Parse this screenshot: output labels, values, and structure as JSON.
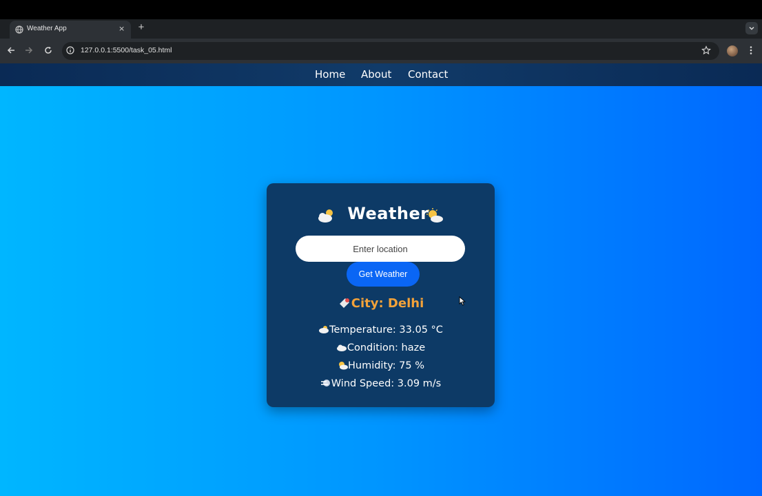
{
  "browser": {
    "tab_title": "Weather App",
    "tab_close": "×",
    "new_tab": "+",
    "url": "127.0.0.1:5500/task_05.html"
  },
  "site_nav": {
    "links": [
      "Home",
      "About",
      "Contact"
    ]
  },
  "weather_card": {
    "title": "Weather",
    "input_placeholder": "Enter location",
    "button_label": "Get Weather",
    "city_text": "City: Delhi",
    "temperature_text": "Temperature: 33.05 °C",
    "condition_text": "Condition: haze",
    "humidity_text": "Humidity: 75 %",
    "wind_text": "Wind Speed: 3.09 m/s"
  },
  "icons": {
    "title_left": "cloud-sun-icon",
    "title_right": "sun-behind-cloud-icon",
    "city": "pin-icon",
    "temperature": "cloud-icon",
    "condition": "cloud-icon",
    "humidity": "sun-cloud-icon",
    "wind": "wind-icon"
  },
  "colors": {
    "page_gradient_start": "#00b6ff",
    "page_gradient_end": "#0068ff",
    "nav_bg": "#0a2a55",
    "card_bg": "#0d3a66",
    "button_bg": "#0a66f5",
    "city_color": "#f2a23a"
  }
}
